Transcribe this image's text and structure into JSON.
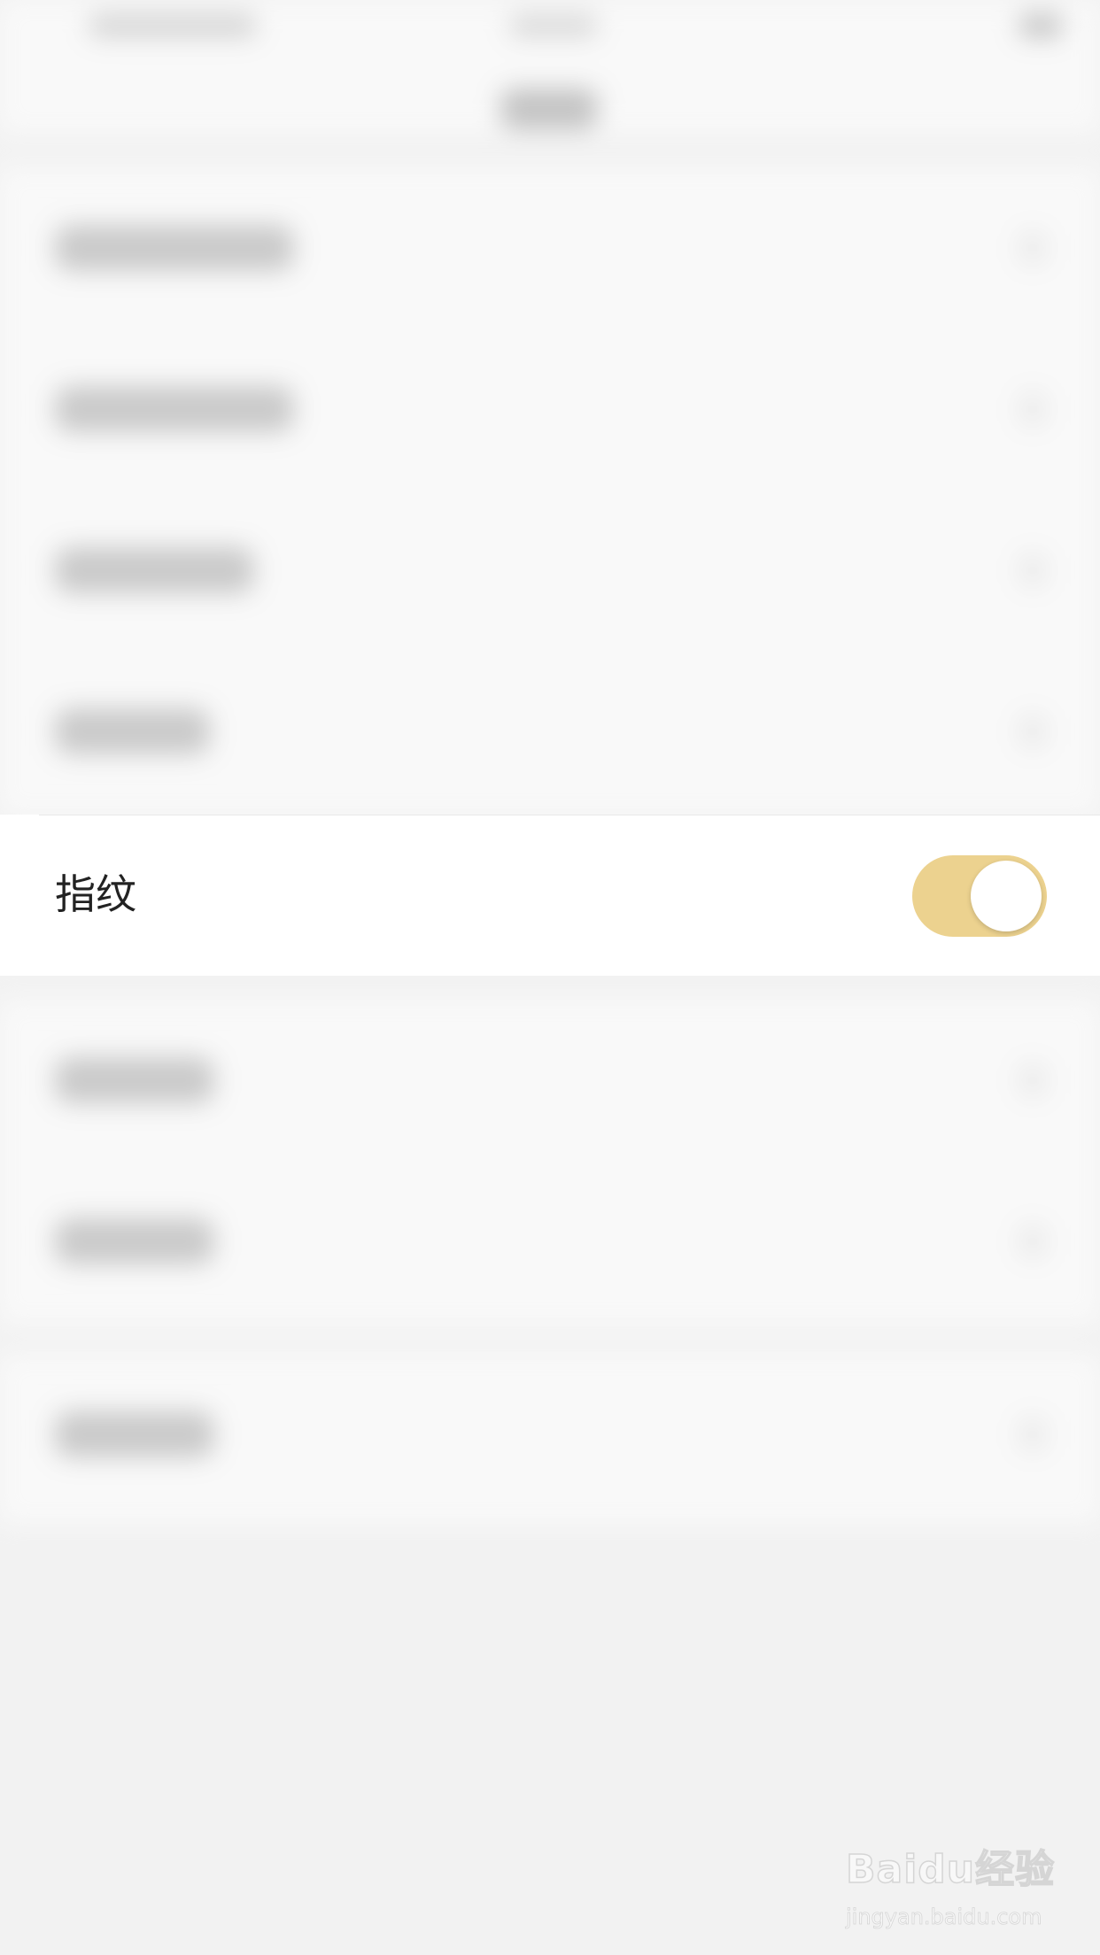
{
  "settings": {
    "fingerprint": {
      "label": "指纹",
      "enabled": true
    }
  },
  "toggle_color": "#ecd28f",
  "watermark": {
    "logo": "Baidu经验",
    "url": "jingyan.baidu.com"
  }
}
